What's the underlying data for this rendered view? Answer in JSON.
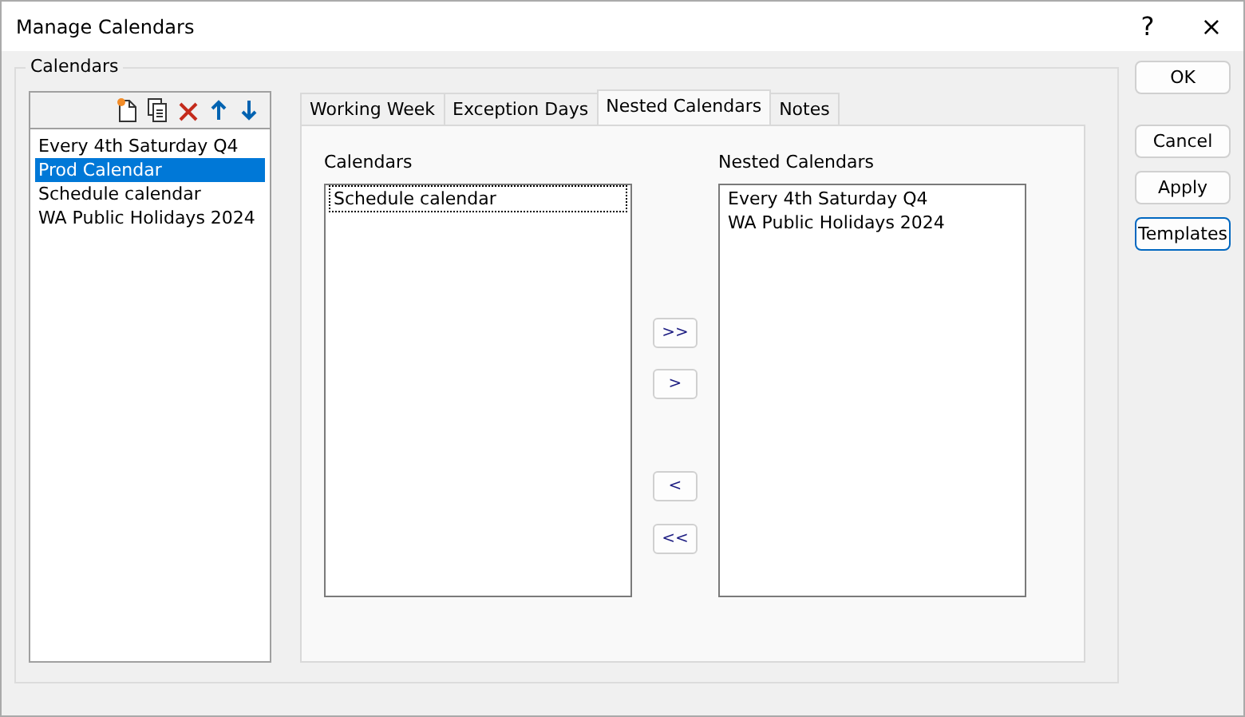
{
  "window": {
    "title": "Manage Calendars",
    "help": "?",
    "close": "×"
  },
  "group": {
    "label": "Calendars"
  },
  "calendar_list": [
    {
      "label": "Every 4th Saturday Q4",
      "selected": false
    },
    {
      "label": "Prod Calendar",
      "selected": true
    },
    {
      "label": "Schedule calendar",
      "selected": false
    },
    {
      "label": "WA Public Holidays 2024",
      "selected": false
    }
  ],
  "tabs": [
    {
      "label": "Working Week",
      "selected": false
    },
    {
      "label": "Exception Days",
      "selected": false
    },
    {
      "label": "Nested Calendars",
      "selected": true
    },
    {
      "label": "Notes",
      "selected": false
    }
  ],
  "available": {
    "label": "Calendars",
    "items": [
      {
        "label": "Schedule calendar",
        "focused": true
      }
    ]
  },
  "nested": {
    "label": "Nested Calendars",
    "items": [
      {
        "label": "Every 4th Saturday Q4",
        "focused": false
      },
      {
        "label": "WA Public Holidays 2024",
        "focused": false
      }
    ]
  },
  "move_buttons": [
    ">>",
    ">",
    "<",
    "<<"
  ],
  "buttons": [
    {
      "label": "OK",
      "default": false
    },
    {
      "label": "Cancel",
      "default": false
    },
    {
      "label": "Apply",
      "default": false
    },
    {
      "label": "Templates",
      "default": true
    }
  ]
}
